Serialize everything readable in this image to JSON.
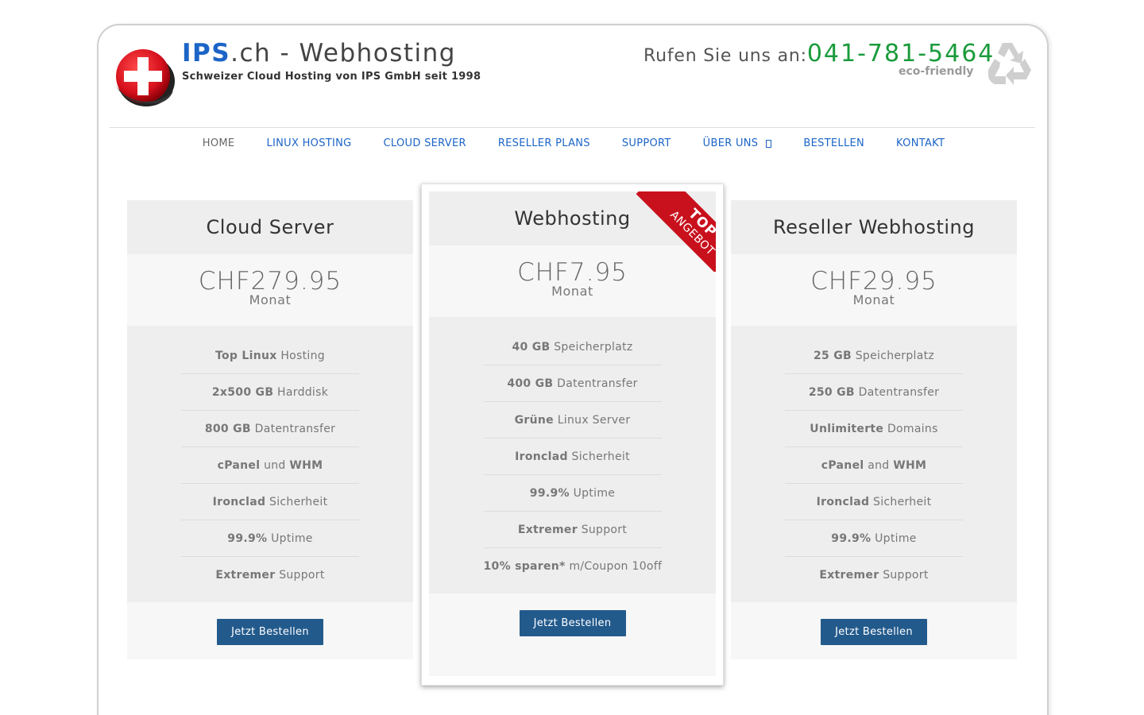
{
  "header": {
    "brand_ips": "IPS",
    "brand_rest": ".ch - Webhosting",
    "subtitle": "Schweizer Cloud Hosting von IPS GmbH seit 1998",
    "call_label": "Rufen Sie uns an:",
    "phone": "041-781-5464",
    "eco": "eco-friendly"
  },
  "nav": {
    "items": [
      {
        "label": "HOME"
      },
      {
        "label": "LINUX HOSTING"
      },
      {
        "label": "CLOUD SERVER"
      },
      {
        "label": "RESELLER PLANS"
      },
      {
        "label": "SUPPORT"
      },
      {
        "label": "ÜBER UNS"
      },
      {
        "label": "BESTELLEN"
      },
      {
        "label": "KONTAKT"
      }
    ]
  },
  "colors": {
    "link": "#1c65c7",
    "phone": "#1a9b3c",
    "button": "#235a8c",
    "ribbon": "#c8111d"
  },
  "plans": [
    {
      "title": "Cloud Server",
      "currency": "CHF",
      "price": "279.95",
      "period": "Monat",
      "features": [
        {
          "strong": "Top Linux",
          "text": " Hosting"
        },
        {
          "strong": "2x500 GB",
          "text": " Harddisk"
        },
        {
          "strong": "800 GB",
          "text": " Datentransfer"
        },
        {
          "strong": "cPanel",
          "text": " und ",
          "strong2": "WHM"
        },
        {
          "strong": "Ironclad",
          "text": " Sicherheit"
        },
        {
          "strong": "99.9%",
          "text": " Uptime"
        },
        {
          "strong": "Extremer",
          "text": " Support"
        }
      ],
      "button": "Jetzt Bestellen"
    },
    {
      "title": "Webhosting",
      "currency": "CHF",
      "price": "7.95",
      "period": "Monat",
      "ribbon_top": "TOP",
      "ribbon_bottom": "ANGEBOT",
      "features": [
        {
          "strong": "40 GB",
          "text": " Speicherplatz"
        },
        {
          "strong": "400 GB",
          "text": " Datentransfer"
        },
        {
          "strong": "Grüne",
          "text": " Linux Server"
        },
        {
          "strong": "Ironclad",
          "text": " Sicherheit"
        },
        {
          "strong": "99.9%",
          "text": " Uptime"
        },
        {
          "strong": "Extremer",
          "text": " Support"
        },
        {
          "strong": "10% sparen*",
          "text": " m/Coupon 10off"
        }
      ],
      "button": "Jetzt Bestellen"
    },
    {
      "title": "Reseller Webhosting",
      "currency": "CHF",
      "price": "29.95",
      "period": "Monat",
      "features": [
        {
          "strong": "25 GB",
          "text": " Speicherplatz"
        },
        {
          "strong": "250 GB",
          "text": " Datentransfer"
        },
        {
          "strong": "Unlimiterte",
          "text": " Domains"
        },
        {
          "strong": "cPanel",
          "text": " and ",
          "strong2": "WHM"
        },
        {
          "strong": "Ironclad",
          "text": " Sicherheit"
        },
        {
          "strong": "99.9%",
          "text": " Uptime"
        },
        {
          "strong": "Extremer",
          "text": " Support"
        }
      ],
      "button": "Jetzt Bestellen"
    }
  ]
}
